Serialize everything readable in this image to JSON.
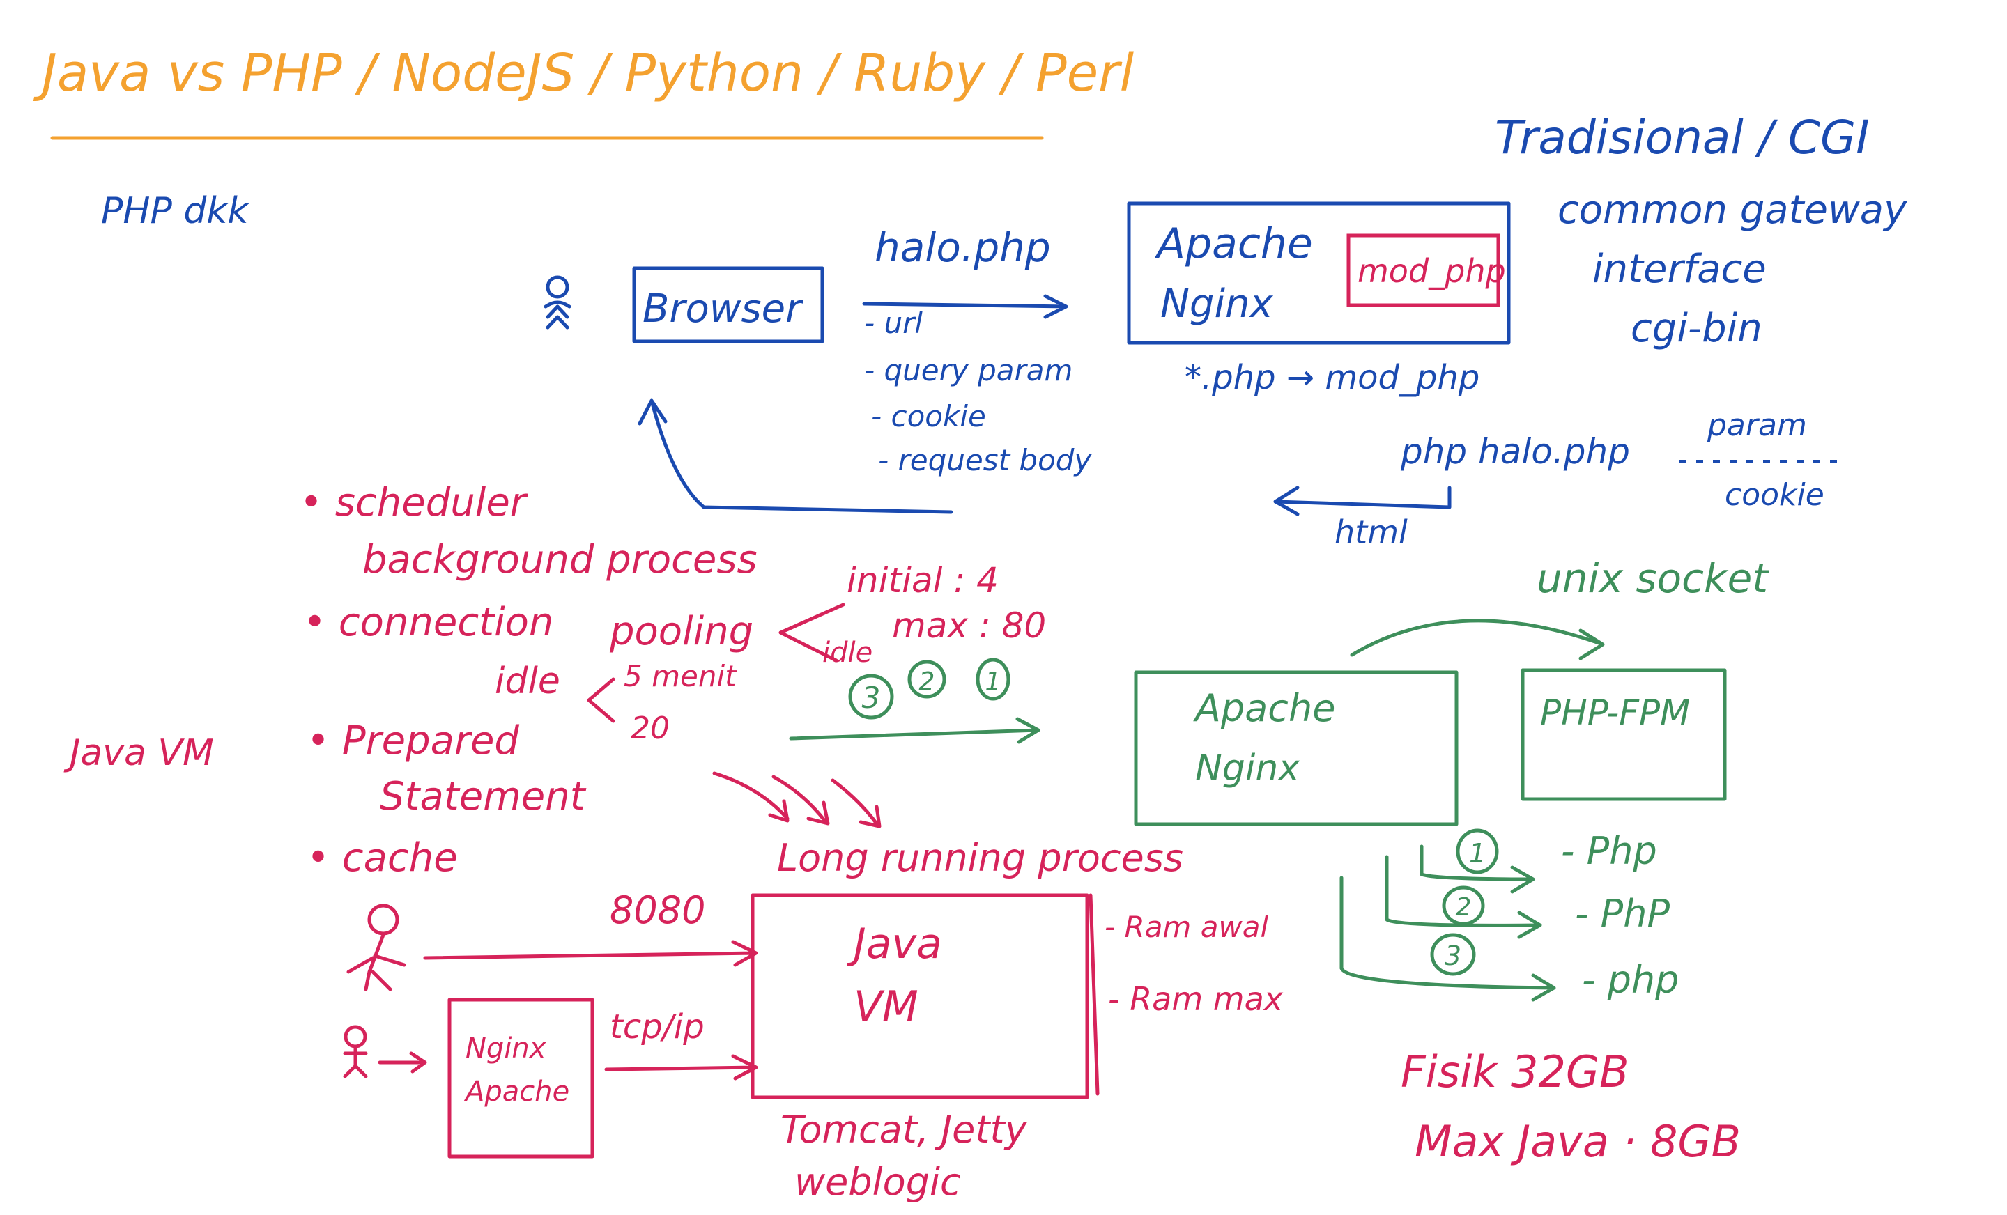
{
  "colors": {
    "orange": "#F4A12F",
    "blue": "#1A4AB0",
    "red": "#D6235A",
    "green": "#3E8F5B"
  },
  "title": "Java  vs PHP / NodeJS / Python / Ruby / Perl",
  "blue_section": {
    "php_dll": "PHP dkk",
    "traditional": "Tradisional / CGI",
    "cgi_full_1": "common gateway",
    "cgi_full_2": "interface",
    "cgi_bin": "cgi-bin",
    "browser": "Browser",
    "request_file": "halo.php",
    "request_parts": [
      "- url",
      "- query param",
      "- cookie",
      "- request body"
    ],
    "server_1": "Apache",
    "server_2": "Nginx",
    "module": "mod_php",
    "mapping": "*.php → mod_php",
    "command": "php halo.php",
    "param": "param",
    "cookie": "cookie",
    "response": "html"
  },
  "green_section": {
    "socket": "unix socket",
    "server_1": "Apache",
    "server_2": "Nginx",
    "fpm": "PHP-FPM",
    "pool_initial": "initial : 4",
    "pool_max": "max : 80",
    "pool_idle": "idle",
    "pool_badges": [
      "3",
      "2",
      "1"
    ],
    "worker_badges": [
      "1",
      "2",
      "3"
    ],
    "workers": [
      "- Php",
      "- PhP",
      "- php"
    ]
  },
  "red_section": {
    "java_vm_side": "Java VM",
    "features": [
      "• scheduler",
      "background process",
      "• connection",
      "pooling",
      "• Prepared",
      "Statement",
      "• cache"
    ],
    "idle_label": "idle",
    "idle_values": [
      "5 menit",
      "20"
    ],
    "long_running": "Long running process",
    "port": "8080",
    "protocol": "tcp/ip",
    "proxy_1": "Nginx",
    "proxy_2": "Apache",
    "jvm_1": "Java",
    "jvm_2": "VM",
    "ram_1": "- Ram awal",
    "ram_2": "- Ram max",
    "servers_1": "Tomcat, Jetty",
    "servers_2": "weblogic",
    "physical": "Fisik   32GB",
    "max_java": "Max Java  ·  8GB"
  }
}
